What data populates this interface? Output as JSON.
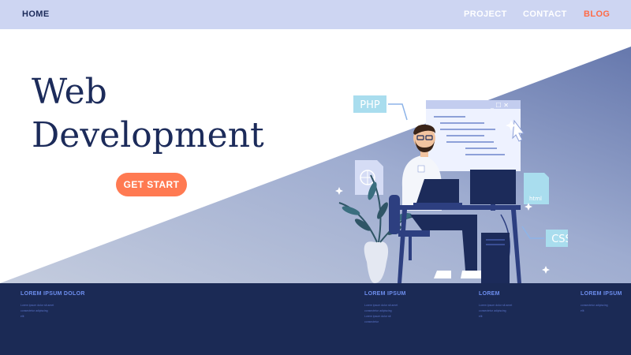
{
  "nav": {
    "home": "HOME",
    "project": "PROJECT",
    "contact": "CONTACT",
    "blog": "BLOG"
  },
  "hero": {
    "title_line1": "Web",
    "title_line2": "Development",
    "cta_label": "GET START"
  },
  "illustration": {
    "php_label": "PHP",
    "css_label": "CSS",
    "html_label": "html"
  },
  "footer": {
    "columns": [
      {
        "heading": "LOREM IPSUM DOLOR",
        "lines": [
          "Lorem ipsum dolor sit amet",
          "consectetur adipiscing",
          "elit"
        ]
      },
      {
        "heading": "LOREM IPSUM",
        "lines": [
          "Lorem ipsum dolor sit amet",
          "consectetur adipiscing",
          "Lorem ipsum dolor sit",
          "consectetur"
        ]
      },
      {
        "heading": "LOREM",
        "lines": [
          "Lorem ipsum dolor sit amet",
          "consectetur adipiscing",
          "elit"
        ]
      },
      {
        "heading": "LOREM IPSUM",
        "lines": [
          "consectetur adipiscing",
          "elit"
        ]
      }
    ]
  },
  "colors": {
    "navy": "#1c2b5a",
    "nav_bg": "#cdd5f2",
    "accent": "#ff7a52",
    "footer_bg": "#1b2a55"
  }
}
